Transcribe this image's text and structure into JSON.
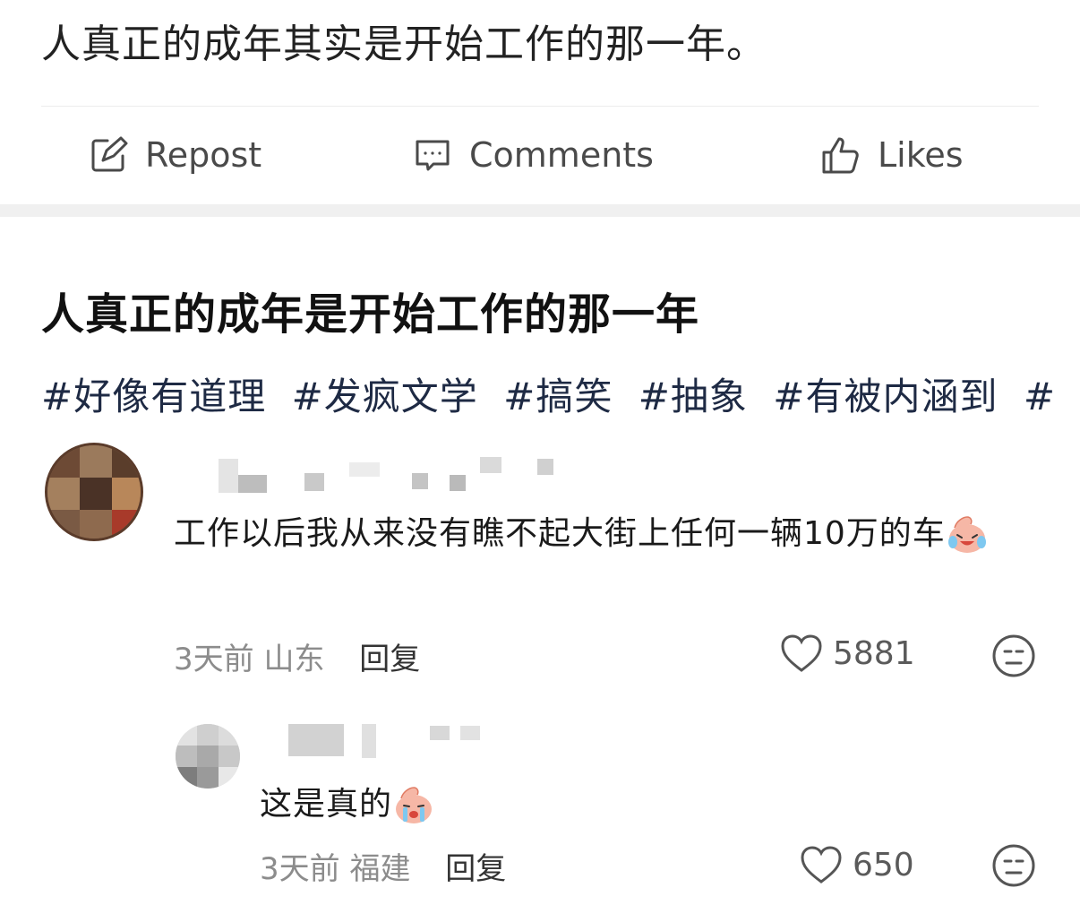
{
  "post": {
    "text": "人真正的成年其实是开始工作的那一年。",
    "actions": {
      "repost": "Repost",
      "comments": "Comments",
      "likes": "Likes"
    }
  },
  "thread": {
    "title": "人真正的成年是开始工作的那一年",
    "tags": [
      "#好像有道理",
      "#发疯文学",
      "#搞笑",
      "#抽象",
      "#有被内涵到",
      "#"
    ]
  },
  "comments": [
    {
      "text": "工作以后我从来没有瞧不起大街上任何一辆10万的车",
      "emoji": "crying-laughing-emoji",
      "time": "3天前",
      "location": "山东",
      "reply": "回复",
      "likes": "5881"
    },
    {
      "text": "这是真的",
      "emoji": "crying-emoji",
      "time": "3天前",
      "location": "福建",
      "reply": "回复",
      "likes": "650"
    }
  ],
  "colors": {
    "tag": "#1e2a44",
    "meta": "#8c8c8c",
    "divider": "#ececec"
  }
}
